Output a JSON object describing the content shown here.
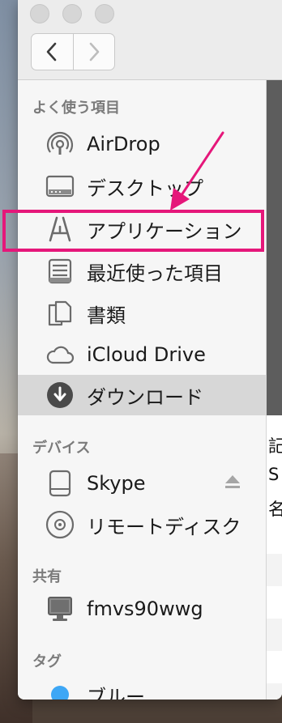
{
  "sidebar": {
    "favorites_title": "よく使う項目",
    "favorites": [
      {
        "label": "AirDrop",
        "icon": "airdrop-icon"
      },
      {
        "label": "デスクトップ",
        "icon": "desktop-icon"
      },
      {
        "label": "アプリケーション",
        "icon": "applications-icon"
      },
      {
        "label": "最近使った項目",
        "icon": "recents-icon"
      },
      {
        "label": "書類",
        "icon": "documents-icon"
      },
      {
        "label": "iCloud Drive",
        "icon": "icloud-icon"
      },
      {
        "label": "ダウンロード",
        "icon": "downloads-icon"
      }
    ],
    "devices_title": "デバイス",
    "devices": [
      {
        "label": "Skype",
        "icon": "disk-icon"
      },
      {
        "label": "リモートディスク",
        "icon": "remote-disc-icon"
      }
    ],
    "shared_title": "共有",
    "shared": [
      {
        "label": "fmvs90wwg",
        "icon": "computer-icon"
      }
    ],
    "tags_title": "タグ",
    "tags": [
      {
        "label": "ブルー",
        "color": "#3ea7f5"
      }
    ]
  },
  "right_strip_text": [
    "記",
    "S",
    "名"
  ],
  "annotation_color": "#e5177a"
}
